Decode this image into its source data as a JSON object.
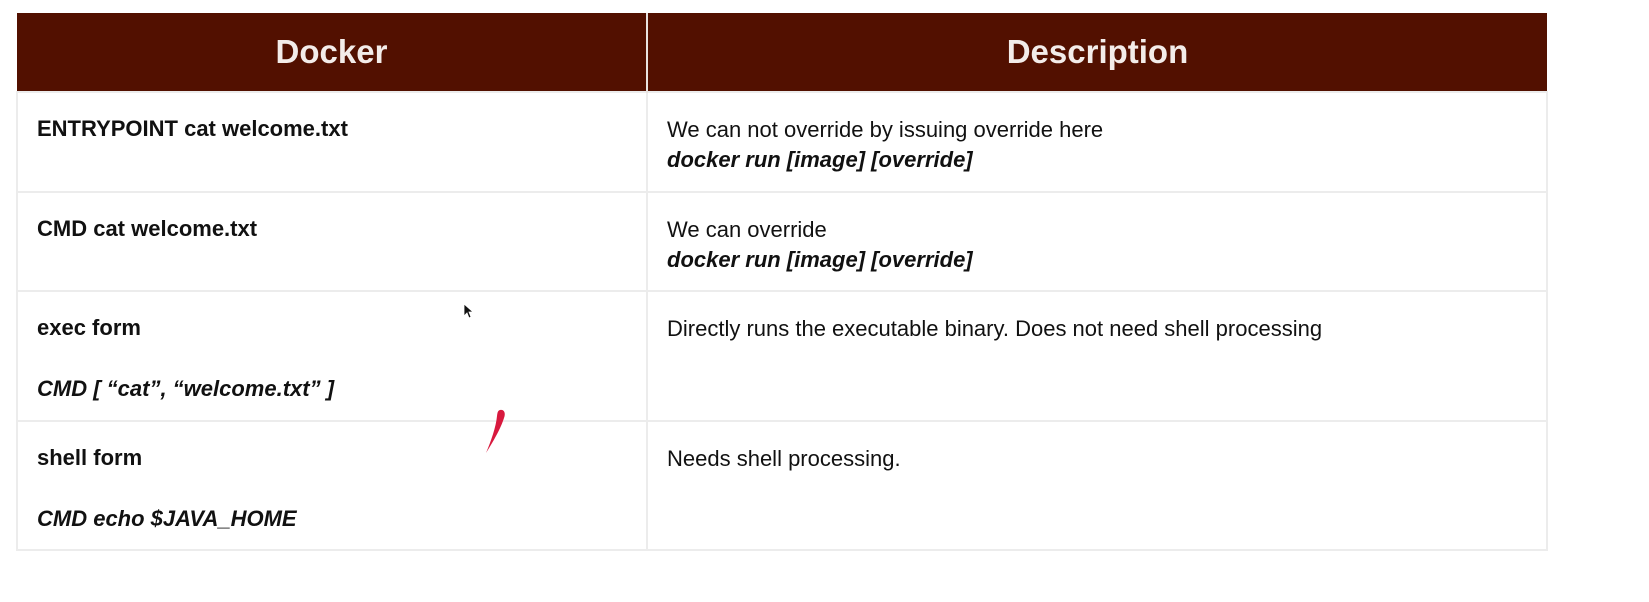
{
  "table": {
    "headers": [
      "Docker",
      "Description"
    ],
    "rows": [
      {
        "docker_line1": "ENTRYPOINT cat welcome.txt",
        "desc_line1": "We can not override by issuing override here",
        "desc_line2": "docker run [image] [override]"
      },
      {
        "docker_line1": "CMD cat welcome.txt",
        "desc_line1": "We can override",
        "desc_line2": "docker run [image] [override]"
      },
      {
        "docker_line1": "exec form",
        "docker_line2": "CMD [ “cat”, “welcome.txt” ]",
        "desc_line1": "Directly runs the executable binary. Does not need shell processing"
      },
      {
        "docker_line1": "shell form",
        "docker_line2": "CMD echo $JAVA_HOME",
        "desc_line1": "Needs shell processing."
      }
    ]
  },
  "colors": {
    "header_bg": "#521000",
    "header_text": "#f3ece9",
    "grid_line": "#ececec",
    "pen_mark": "#d8193e"
  },
  "icons": [
    "mouse-cursor-icon",
    "annotation-pen-mark"
  ]
}
